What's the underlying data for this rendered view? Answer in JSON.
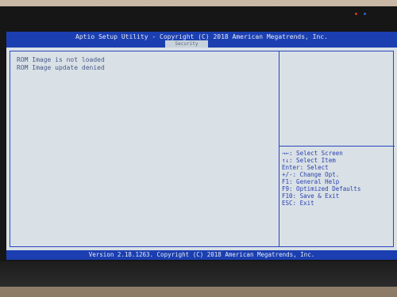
{
  "header": {
    "title": "Aptio Setup Utility - Copyright (C) 2018 American Megatrends, Inc.",
    "tab_label": "Security"
  },
  "messages": [
    "ROM Image is not loaded",
    "ROM Image update denied"
  ],
  "help": [
    "→←: Select Screen",
    "↑↓: Select Item",
    "Enter: Select",
    "+/-: Change Opt.",
    "F1: General Help",
    "F9: Optimized Defaults",
    "F10: Save & Exit",
    "ESC: Exit"
  ],
  "footer": {
    "version": "Version 2.18.1263. Copyright (C) 2018 American Megatrends, Inc."
  },
  "colors": {
    "bar_blue": "#1b3fb0",
    "screen_bg": "#d9e1e6",
    "help_text": "#2a3fb0",
    "message_text": "#4a5a8a",
    "led_red": "#d23a2a",
    "led_blue": "#3b5bd6"
  }
}
